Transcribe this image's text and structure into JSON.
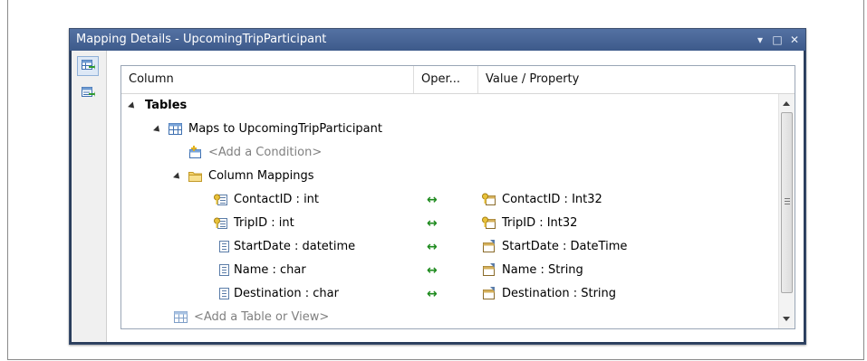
{
  "window": {
    "title": "Mapping Details - UpcomingTripParticipant",
    "controls": {
      "dropdown": "▾",
      "maximize": "□",
      "close": "✕"
    }
  },
  "sidebar": {
    "buttons": [
      {
        "name": "map-entity-to-tables",
        "active": true
      },
      {
        "name": "map-entity-to-functions",
        "active": false
      }
    ]
  },
  "grid": {
    "columns": [
      "Column",
      "Oper...",
      "Value / Property"
    ],
    "tables_label": "Tables",
    "maps_to": "Maps to UpcomingTripParticipant",
    "add_condition": "<Add a Condition>",
    "column_mappings": "Column Mappings",
    "add_table": "<Add a Table or View>",
    "mappings": [
      {
        "column": "ContactID : int",
        "operator": "↔",
        "property": "ContactID : Int32",
        "key": true
      },
      {
        "column": "TripID : int",
        "operator": "↔",
        "property": "TripID : Int32",
        "key": true
      },
      {
        "column": "StartDate : datetime",
        "operator": "↔",
        "property": "StartDate : DateTime",
        "key": false
      },
      {
        "column": "Name : char",
        "operator": "↔",
        "property": "Name : String",
        "key": false
      },
      {
        "column": "Destination : char",
        "operator": "↔",
        "property": "Destination : String",
        "key": false
      }
    ]
  },
  "colors": {
    "titlebar": "#4a6797",
    "operator": "#1d8a1d",
    "placeholder": "#808080"
  }
}
